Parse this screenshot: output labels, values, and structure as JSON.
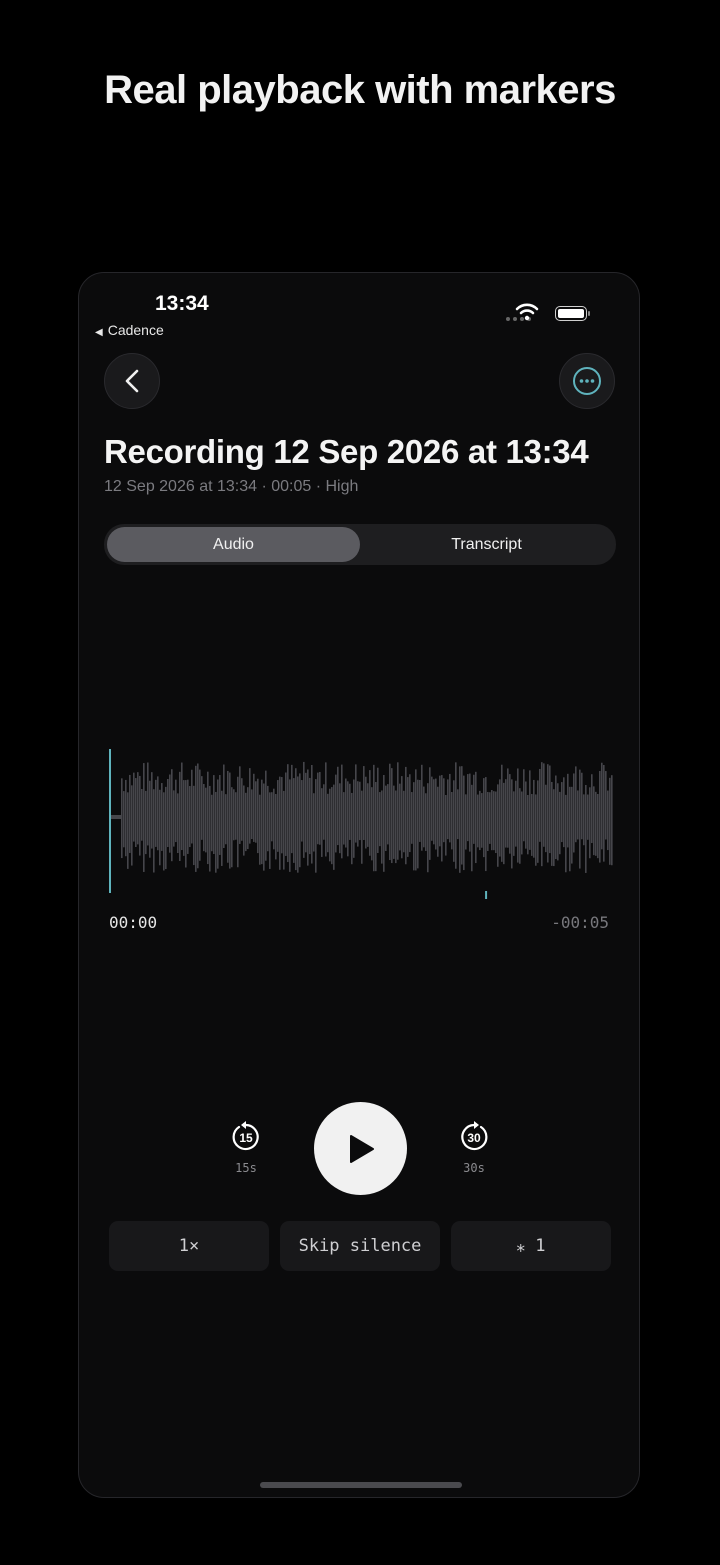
{
  "headline": "Real playback with markers",
  "status_bar": {
    "time": "13:34",
    "back_app": "Cadence"
  },
  "recording": {
    "title": "Recording 12 Sep 2026 at 13:34",
    "meta": "12 Sep 2026 at 13:34 · 00:05 · High"
  },
  "tabs": [
    {
      "label": "Audio",
      "active": true
    },
    {
      "label": "Transcript",
      "active": false
    }
  ],
  "player": {
    "elapsed": "00:00",
    "remaining": "-00:05",
    "progress": 0,
    "marker_fraction": 0.74,
    "skip_back_number": "15",
    "skip_back_label": "15s",
    "skip_forward_number": "30",
    "skip_forward_label": "30s"
  },
  "controls": {
    "speed": "1×",
    "skip_silence": "Skip silence",
    "markers": "⁎ 1"
  },
  "colors": {
    "accent": "#5fb3bd",
    "waveform": "#46464b",
    "background": "#0b0b0c"
  }
}
